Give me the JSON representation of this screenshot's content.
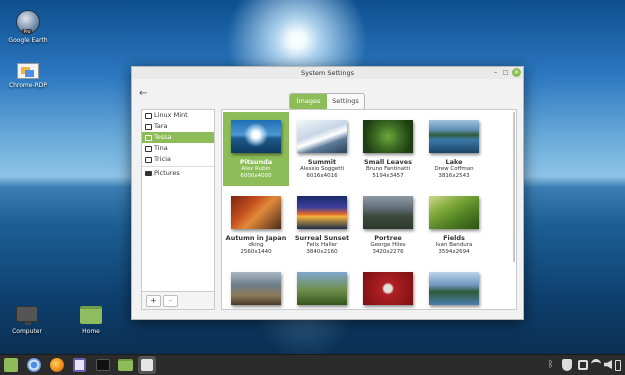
{
  "desktop": {
    "icons": [
      {
        "label": "Google Earth",
        "icon": "google-earth-icon"
      },
      {
        "label": "Chrome-RDP",
        "icon": "chrome-rdp-icon"
      },
      {
        "label": "Computer",
        "icon": "computer-icon"
      },
      {
        "label": "Home",
        "icon": "home-folder-icon"
      }
    ]
  },
  "window": {
    "title": "System Settings",
    "controls": {
      "minimize": "–",
      "maximize": "□",
      "close": "✕"
    },
    "back_icon": "←",
    "tabs": [
      {
        "label": "Images",
        "active": true
      },
      {
        "label": "Settings",
        "active": false
      }
    ],
    "accent_color": "#8dbd58"
  },
  "sidebar": {
    "items": [
      {
        "label": "Linux Mint",
        "icon": "monitor-icon",
        "selected": false
      },
      {
        "label": "Tara",
        "icon": "monitor-icon",
        "selected": false
      },
      {
        "label": "Tessa",
        "icon": "monitor-icon",
        "selected": true
      },
      {
        "label": "Tina",
        "icon": "monitor-icon",
        "selected": false
      },
      {
        "label": "Tricia",
        "icon": "monitor-icon",
        "selected": false
      },
      {
        "label": "Pictures",
        "icon": "camera-icon",
        "selected": false
      }
    ],
    "add_label": "+",
    "remove_label": "–"
  },
  "gallery": {
    "tiles": [
      {
        "name": "Pitsunda",
        "author": "Alex Rubin",
        "size": "6000x4000",
        "selected": true
      },
      {
        "name": "Summit",
        "author": "Alessio Soggetti",
        "size": "6016x4016",
        "selected": false
      },
      {
        "name": "Small Leaves",
        "author": "Bruno Fantinatti",
        "size": "5194x3457",
        "selected": false
      },
      {
        "name": "Lake",
        "author": "Drew Coffman",
        "size": "3816x2543",
        "selected": false
      },
      {
        "name": "Autumn in Japan",
        "author": "dking",
        "size": "2560x1440",
        "selected": false
      },
      {
        "name": "Surreal Sunset",
        "author": "Felix Haller",
        "size": "3840x2160",
        "selected": false
      },
      {
        "name": "Portree",
        "author": "George Hiles",
        "size": "3420x2276",
        "selected": false
      },
      {
        "name": "Fields",
        "author": "Ivan Bandura",
        "size": "3594x2694",
        "selected": false
      },
      {
        "name": "",
        "author": "",
        "size": "",
        "selected": false
      },
      {
        "name": "",
        "author": "",
        "size": "",
        "selected": false
      },
      {
        "name": "",
        "author": "",
        "size": "",
        "selected": false
      },
      {
        "name": "",
        "author": "",
        "size": "",
        "selected": false
      }
    ]
  },
  "taskbar": {
    "launchers": [
      "menu-icon",
      "chromium-icon",
      "firefox-icon",
      "notes-icon",
      "terminal-icon",
      "files-icon",
      "settings-icon"
    ],
    "tray": [
      "bluetooth-icon",
      "shield-icon",
      "network-icon",
      "wifi-icon",
      "volume-icon",
      "battery-icon"
    ]
  }
}
